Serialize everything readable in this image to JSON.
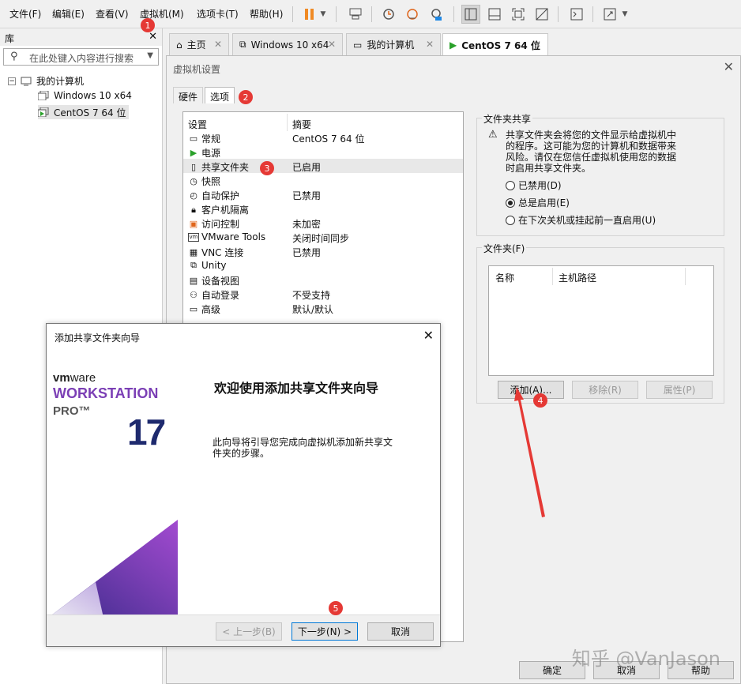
{
  "menu": {
    "items": [
      "文件(F)",
      "编辑(E)",
      "查看(V)",
      "虚拟机(M)",
      "选项卡(T)",
      "帮助(H)"
    ]
  },
  "library": {
    "title": "库",
    "search_placeholder": "在此处键入内容进行搜索",
    "root": "我的计算机",
    "vms": [
      "Windows 10 x64",
      "CentOS 7 64 位"
    ]
  },
  "tabs": [
    {
      "label": "主页",
      "icon": "home-icon"
    },
    {
      "label": "Windows 10 x64",
      "icon": "vm-icon"
    },
    {
      "label": "我的计算机",
      "icon": "computer-icon"
    },
    {
      "label": "CentOS 7 64 位",
      "icon": "vm-running-icon"
    }
  ],
  "settings": {
    "title": "虚拟机设置",
    "tabs": [
      "硬件",
      "选项"
    ],
    "col_setting": "设置",
    "col_summary": "摘要",
    "rows": [
      {
        "name": "常规",
        "summary": "CentOS 7 64 位",
        "icon": "general-icon"
      },
      {
        "name": "电源",
        "summary": "",
        "icon": "power-icon"
      },
      {
        "name": "共享文件夹",
        "summary": "已启用",
        "icon": "shared-folder-icon"
      },
      {
        "name": "快照",
        "summary": "",
        "icon": "snapshot-icon"
      },
      {
        "name": "自动保护",
        "summary": "已禁用",
        "icon": "autoprotect-icon"
      },
      {
        "name": "客户机隔离",
        "summary": "",
        "icon": "lock-icon"
      },
      {
        "name": "访问控制",
        "summary": "未加密",
        "icon": "access-control-icon"
      },
      {
        "name": "VMware Tools",
        "summary": "关闭时间同步",
        "icon": "vmware-tools-icon"
      },
      {
        "name": "VNC 连接",
        "summary": "已禁用",
        "icon": "vnc-icon"
      },
      {
        "name": "Unity",
        "summary": "",
        "icon": "unity-icon"
      },
      {
        "name": "设备视图",
        "summary": "",
        "icon": "device-view-icon"
      },
      {
        "name": "自动登录",
        "summary": "不受支持",
        "icon": "autologin-icon"
      },
      {
        "name": "高级",
        "summary": "默认/默认",
        "icon": "advanced-icon"
      }
    ],
    "sharing": {
      "title": "文件夹共享",
      "warning": [
        "共享文件夹会将您的文件显示给虚拟机中",
        "的程序。这可能为您的计算机和数据带来",
        "风险。请仅在您信任虚拟机使用您的数据",
        "时启用共享文件夹。"
      ],
      "options": [
        "已禁用(D)",
        "总是启用(E)",
        "在下次关机或挂起前一直启用(U)"
      ],
      "selected": 1
    },
    "folders": {
      "title": "文件夹(F)",
      "col_name": "名称",
      "col_path": "主机路径",
      "add": "添加(A)...",
      "remove": "移除(R)",
      "properties": "属性(P)"
    },
    "ok": "确定",
    "cancel": "取消",
    "help": "帮助"
  },
  "wizard": {
    "title": "添加共享文件夹向导",
    "brand_vm": "vm",
    "brand_ware": "ware",
    "brand_workstation": "WORKSTATION",
    "brand_pro": "PRO™",
    "brand_version": "17",
    "heading": "欢迎使用添加共享文件夹向导",
    "body": [
      "此向导将引导您完成向虚拟机添加新共享文",
      "件夹的步骤。"
    ],
    "back": "< 上一步(B)",
    "next": "下一步(N) >",
    "cancel": "取消"
  },
  "annotations": [
    "1",
    "2",
    "3",
    "4",
    "5"
  ],
  "watermark": "知乎 @VanJason",
  "colors": {
    "accent": "#0078d7",
    "badge": "#e53935",
    "purple": "#7b3fb5",
    "play": "#2aa12a"
  }
}
